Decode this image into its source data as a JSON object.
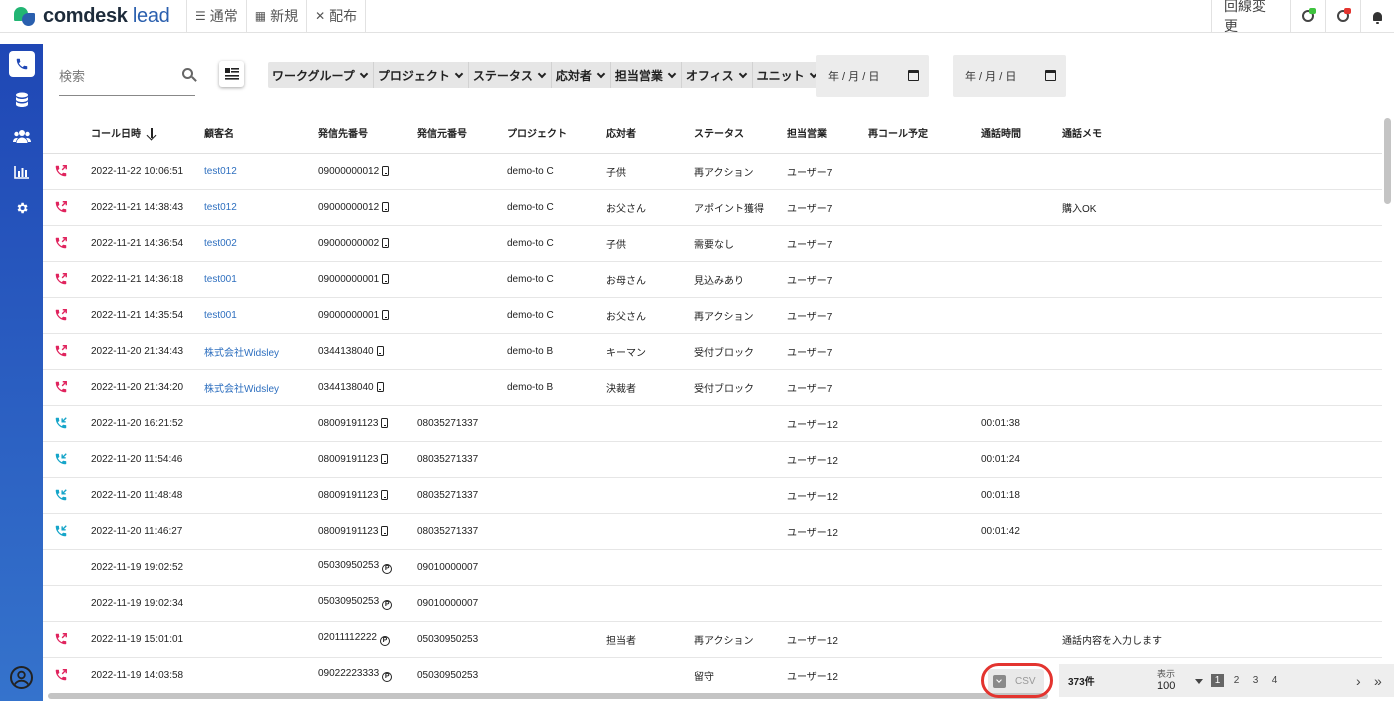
{
  "app": {
    "brand": "comdesk",
    "brand_suffix": "lead"
  },
  "topnav": [
    {
      "label": "通常",
      "icon": "list-icon"
    },
    {
      "label": "新規",
      "icon": "grid-icon"
    },
    {
      "label": "配布",
      "icon": "distribute-icon"
    }
  ],
  "topright": {
    "line_change": "回線変更"
  },
  "colors": {
    "sidebar_top": "#1f47b5",
    "sidebar_bottom": "#3573cc",
    "outgoing": "#e0245e",
    "incoming": "#16a5c9",
    "link": "#2e6fbf",
    "highlight": "#e3342f",
    "status_green": "#3ec33e",
    "status_red": "#e3342f"
  },
  "search": {
    "placeholder": "検索"
  },
  "filters": [
    "ワークグループ",
    "プロジェクト",
    "ステータス",
    "応対者",
    "担当営業",
    "オフィス",
    "ユニット"
  ],
  "date_from": {
    "placeholder": "年 / 月 / 日"
  },
  "date_to": {
    "placeholder": "年 / 月 / 日"
  },
  "columns": [
    "コール日時",
    "顧客名",
    "発信先番号",
    "発信元番号",
    "プロジェクト",
    "応対者",
    "ステータス",
    "担当営業",
    "再コール予定",
    "通話時間",
    "通話メモ"
  ],
  "rows": [
    {
      "dir": "out",
      "datetime": "2022-11-22 10:06:51",
      "customer": "test012",
      "to": "09000000012",
      "to_tag": "mobile",
      "from": "",
      "project": "demo-to C",
      "responder": "子供",
      "status": "再アクション",
      "sales": "ユーザー7",
      "recall": "",
      "duration": "",
      "memo": ""
    },
    {
      "dir": "out",
      "datetime": "2022-11-21 14:38:43",
      "customer": "test012",
      "to": "09000000012",
      "to_tag": "mobile",
      "from": "",
      "project": "demo-to C",
      "responder": "お父さん",
      "status": "アポイント獲得",
      "sales": "ユーザー7",
      "recall": "",
      "duration": "",
      "memo": "購入OK"
    },
    {
      "dir": "out",
      "datetime": "2022-11-21 14:36:54",
      "customer": "test002",
      "to": "09000000002",
      "to_tag": "mobile",
      "from": "",
      "project": "demo-to C",
      "responder": "子供",
      "status": "需要なし",
      "sales": "ユーザー7",
      "recall": "",
      "duration": "",
      "memo": ""
    },
    {
      "dir": "out",
      "datetime": "2022-11-21 14:36:18",
      "customer": "test001",
      "to": "09000000001",
      "to_tag": "mobile",
      "from": "",
      "project": "demo-to C",
      "responder": "お母さん",
      "status": "見込みあり",
      "sales": "ユーザー7",
      "recall": "",
      "duration": "",
      "memo": ""
    },
    {
      "dir": "out",
      "datetime": "2022-11-21 14:35:54",
      "customer": "test001",
      "to": "09000000001",
      "to_tag": "mobile",
      "from": "",
      "project": "demo-to C",
      "responder": "お父さん",
      "status": "再アクション",
      "sales": "ユーザー7",
      "recall": "",
      "duration": "",
      "memo": ""
    },
    {
      "dir": "out",
      "datetime": "2022-11-20 21:34:43",
      "customer": "株式会社Widsley",
      "to": "0344138040",
      "to_tag": "mobile",
      "from": "",
      "project": "demo-to B",
      "responder": "キーマン",
      "status": "受付ブロック",
      "sales": "ユーザー7",
      "recall": "",
      "duration": "",
      "memo": ""
    },
    {
      "dir": "out",
      "datetime": "2022-11-20 21:34:20",
      "customer": "株式会社Widsley",
      "to": "0344138040",
      "to_tag": "mobile",
      "from": "",
      "project": "demo-to B",
      "responder": "決裁者",
      "status": "受付ブロック",
      "sales": "ユーザー7",
      "recall": "",
      "duration": "",
      "memo": ""
    },
    {
      "dir": "in",
      "datetime": "2022-11-20 16:21:52",
      "customer": "",
      "to": "08009191123",
      "to_tag": "mobile",
      "from": "08035271337",
      "project": "",
      "responder": "",
      "status": "",
      "sales": "ユーザー12",
      "recall": "",
      "duration": "00:01:38",
      "memo": ""
    },
    {
      "dir": "in",
      "datetime": "2022-11-20 11:54:46",
      "customer": "",
      "to": "08009191123",
      "to_tag": "mobile",
      "from": "08035271337",
      "project": "",
      "responder": "",
      "status": "",
      "sales": "ユーザー12",
      "recall": "",
      "duration": "00:01:24",
      "memo": ""
    },
    {
      "dir": "in",
      "datetime": "2022-11-20 11:48:48",
      "customer": "",
      "to": "08009191123",
      "to_tag": "mobile",
      "from": "08035271337",
      "project": "",
      "responder": "",
      "status": "",
      "sales": "ユーザー12",
      "recall": "",
      "duration": "00:01:18",
      "memo": ""
    },
    {
      "dir": "in",
      "datetime": "2022-11-20 11:46:27",
      "customer": "",
      "to": "08009191123",
      "to_tag": "mobile",
      "from": "08035271337",
      "project": "",
      "responder": "",
      "status": "",
      "sales": "ユーザー12",
      "recall": "",
      "duration": "00:01:42",
      "memo": ""
    },
    {
      "dir": "none",
      "datetime": "2022-11-19 19:02:52",
      "customer": "",
      "to": "05030950253",
      "to_tag": "p",
      "from": "09010000007",
      "project": "",
      "responder": "",
      "status": "",
      "sales": "",
      "recall": "",
      "duration": "",
      "memo": ""
    },
    {
      "dir": "none",
      "datetime": "2022-11-19 19:02:34",
      "customer": "",
      "to": "05030950253",
      "to_tag": "p",
      "from": "09010000007",
      "project": "",
      "responder": "",
      "status": "",
      "sales": "",
      "recall": "",
      "duration": "",
      "memo": ""
    },
    {
      "dir": "out",
      "datetime": "2022-11-19 15:01:01",
      "customer": "",
      "to": "02011112222",
      "to_tag": "p",
      "from": "05030950253",
      "project": "",
      "responder": "担当者",
      "status": "再アクション",
      "sales": "ユーザー12",
      "recall": "",
      "duration": "",
      "memo": "通話内容を入力します"
    },
    {
      "dir": "out",
      "datetime": "2022-11-19 14:03:58",
      "customer": "",
      "to": "09022223333",
      "to_tag": "p",
      "from": "05030950253",
      "project": "",
      "responder": "",
      "status": "留守",
      "sales": "ユーザー12",
      "recall": "",
      "duration": "",
      "memo": ""
    }
  ],
  "csv": {
    "label": "CSV"
  },
  "pager": {
    "count": "373件",
    "per_page_label": "表示",
    "per_page": "100",
    "pages": [
      "1",
      "2",
      "3",
      "4"
    ],
    "current": "1"
  }
}
